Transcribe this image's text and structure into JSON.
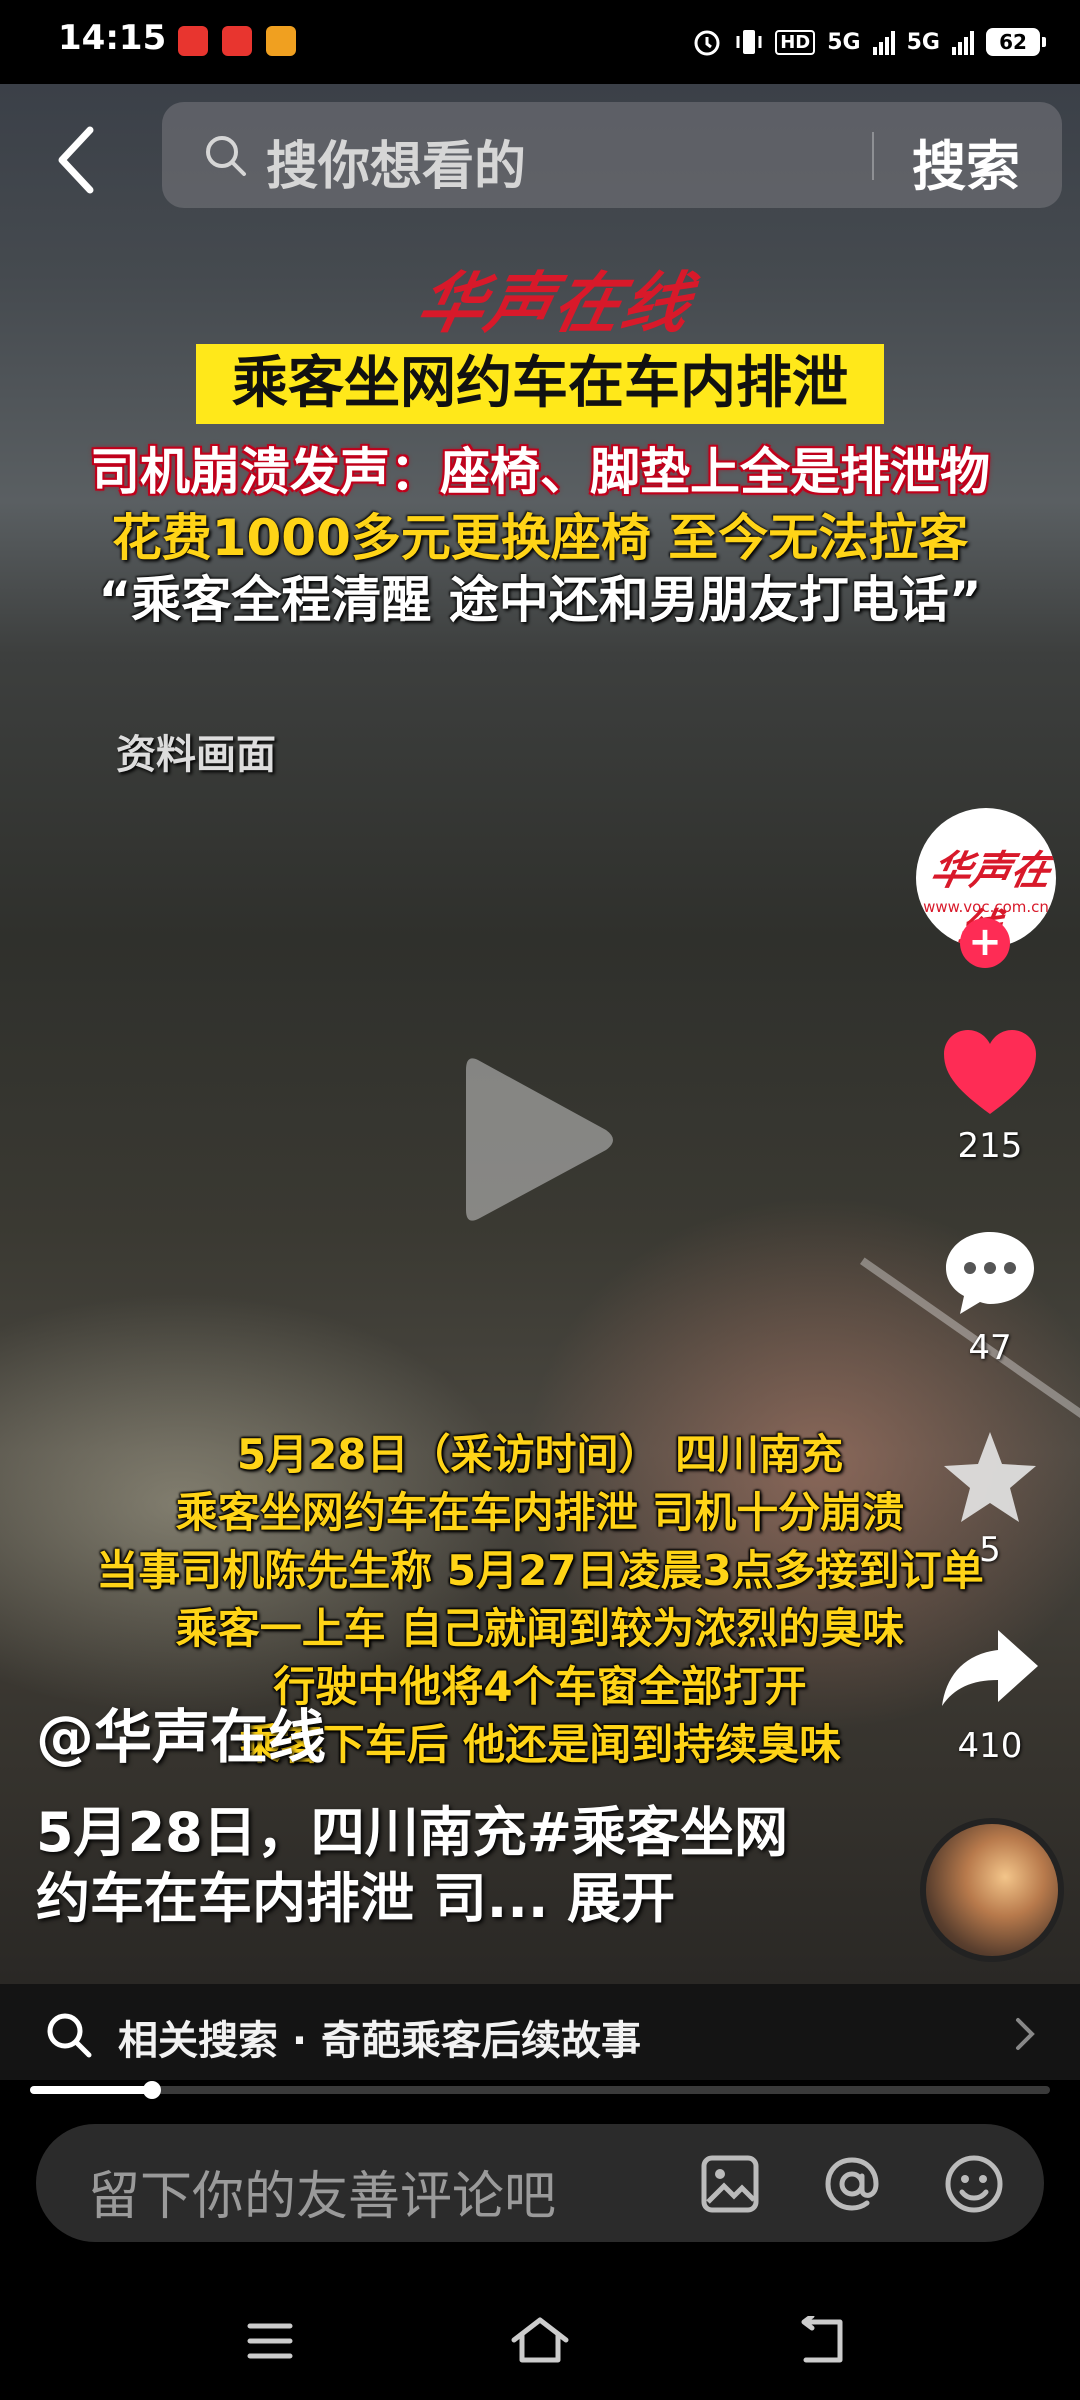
{
  "status_bar": {
    "time": "14:15",
    "network_1": "5G",
    "network_2": "5G",
    "hd_label": "HD",
    "battery": "62"
  },
  "search": {
    "placeholder": "搜你想看的",
    "button_label": "搜索"
  },
  "video": {
    "logo_text": "华声在线",
    "headline": "乘客坐网约车在车内排泄",
    "line_1": "司机崩溃发声：座椅、脚垫上全是排泄物",
    "line_2": "花费1000多元更换座椅 至今无法拉客",
    "line_3": "“乘客全程清醒 途中还和男朋友打电话”",
    "material_label": "资料画面",
    "captions": [
      "5月28日（采访时间） 四川南充",
      "乘客坐网约车在车内排泄 司机十分崩溃",
      "当事司机陈先生称 5月27日凌晨3点多接到订单",
      "乘客一上车 自己就闻到较为浓烈的臭味",
      "行驶中他将4个车窗全部打开",
      "乘客下车后 他还是闻到持续臭味"
    ],
    "progress": 0.12
  },
  "author": {
    "handle": "@华声在线",
    "avatar_text": "华声在线",
    "avatar_url_text": "www.voc.com.cn"
  },
  "description": {
    "text": "5月28日，四川南充#乘客坐网约车在车内排泄 司...",
    "expand_label": "展开"
  },
  "actions": {
    "likes": "215",
    "comments": "47",
    "favorites": "5",
    "shares": "410"
  },
  "related_search": {
    "label": "相关搜索 · 奇葩乘客后续故事"
  },
  "comment_input": {
    "placeholder": "留下你的友善评论吧"
  },
  "colors": {
    "accent_red": "#fe2c55",
    "headline_yellow": "#ffe81a",
    "caption_yellow": "#ffd417"
  }
}
